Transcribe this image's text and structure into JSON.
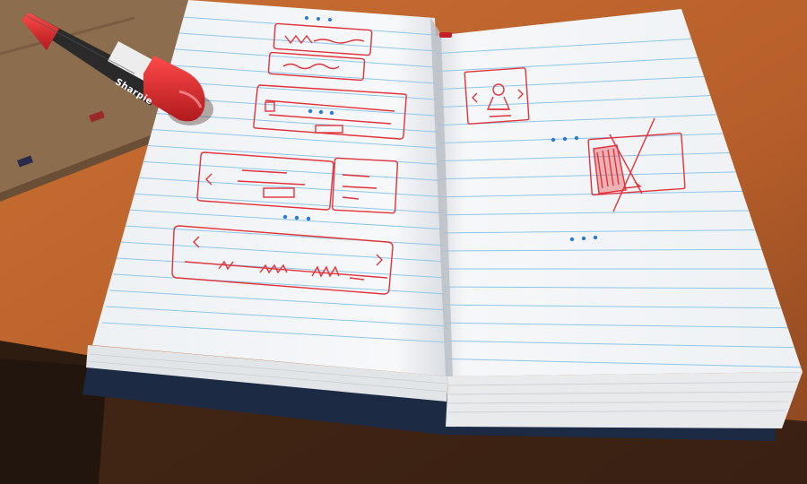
{
  "scene": {
    "description_tags": [
      "desk-photo",
      "open-notebook",
      "ui-sketches",
      "red-marker"
    ],
    "colors": {
      "desk": "#c0692f",
      "desk_dark": "#8a4520",
      "cardboard": "#8a6a4a",
      "paper": "#f4f6f8",
      "rule_blue": "#8ec7e8",
      "sketch_red": "#e0333a",
      "dot_blue": "#2b7bd6",
      "cover_navy": "#1c2a44",
      "pen_red": "#d8262c",
      "pen_black": "#2a2a2a"
    }
  },
  "marker": {
    "brand_text": "Sharpie"
  },
  "notebook": {
    "left_page_sketch_count": 4,
    "right_page_sketch_count": 2
  }
}
